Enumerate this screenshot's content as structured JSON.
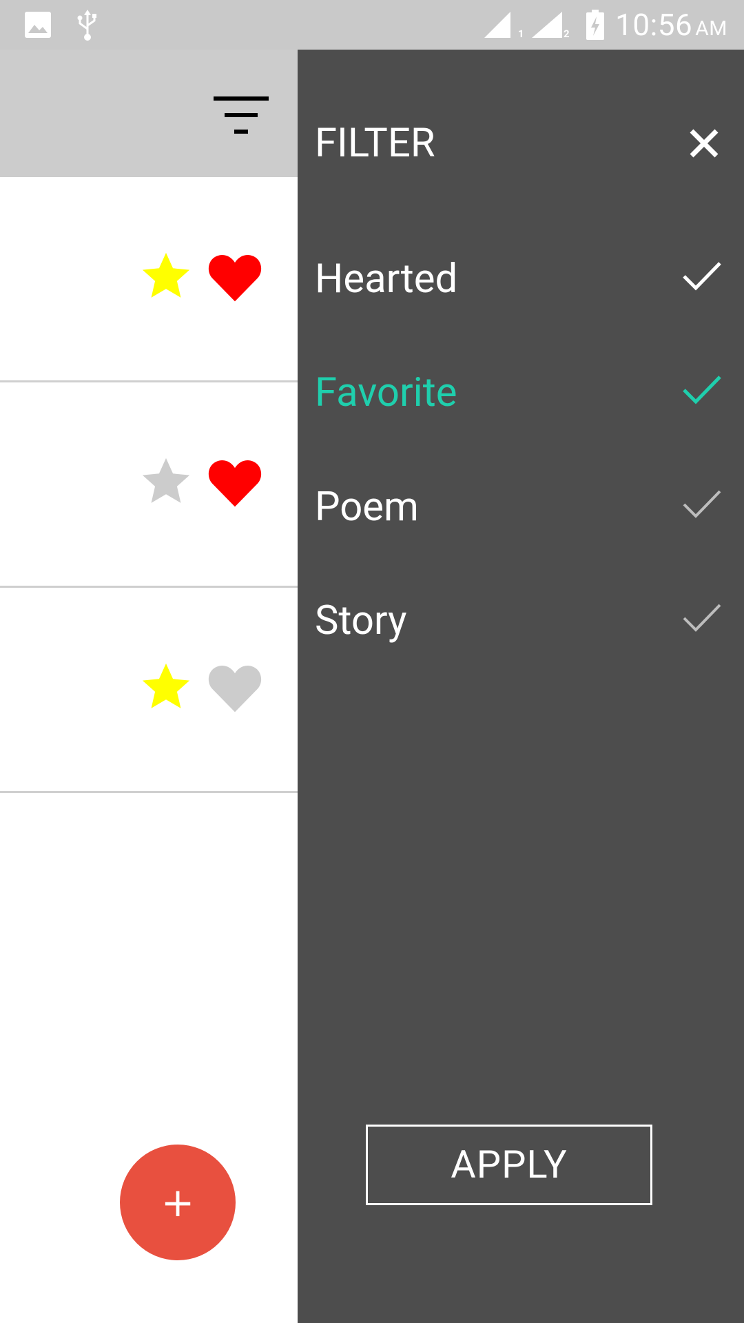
{
  "status_bar": {
    "time": "10:56",
    "ampm": "AM",
    "sim1_label": "1",
    "sim2_label": "2"
  },
  "list": {
    "rows": [
      {
        "favorite": true,
        "hearted": true
      },
      {
        "favorite": false,
        "hearted": true
      },
      {
        "favorite": true,
        "hearted": false
      }
    ]
  },
  "fab": {
    "label": "+"
  },
  "drawer": {
    "title": "FILTER",
    "items": [
      {
        "label": "Hearted",
        "state": "checked"
      },
      {
        "label": "Favorite",
        "state": "active"
      },
      {
        "label": "Poem",
        "state": "unchecked"
      },
      {
        "label": "Story",
        "state": "unchecked"
      }
    ],
    "apply_label": "APPLY"
  },
  "colors": {
    "star_on": "#ffff00",
    "star_off": "#cccccc",
    "heart_on": "#ff0000",
    "heart_off": "#cccccc",
    "accent": "#1fcfad",
    "fab": "#e8503f",
    "drawer_bg": "#4d4d4d"
  }
}
